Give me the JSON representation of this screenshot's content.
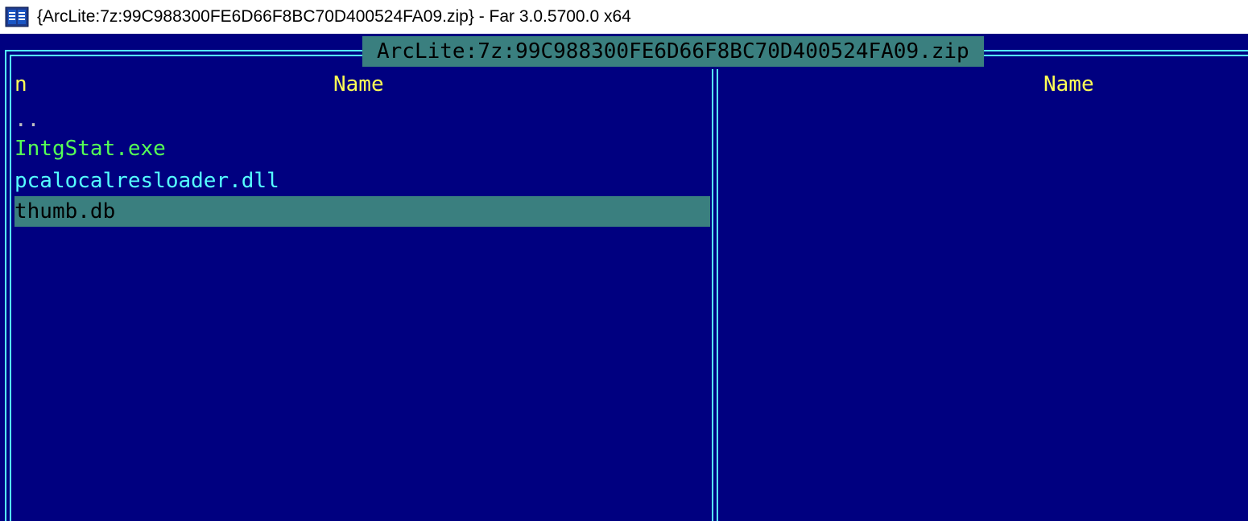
{
  "window": {
    "title": "{ArcLite:7z:99C988300FE6D66F8BC70D400524FA09.zip} - Far 3.0.5700.0 x64",
    "icon": "far-manager-icon"
  },
  "left_panel": {
    "title": "ArcLite:7z:99C988300FE6D66F8BC70D400524FA09.zip",
    "column_marker": "n",
    "column_header": "Name",
    "files": [
      {
        "name": "..",
        "color": "#c0c0c0",
        "selected": false
      },
      {
        "name": "IntgStat.exe",
        "color": "#55ff55",
        "selected": false
      },
      {
        "name": "pcalocalresloader.dll",
        "color": "#55ffff",
        "selected": false
      },
      {
        "name": "thumb.db",
        "color": "#000000",
        "selected": true
      }
    ]
  },
  "right_panel": {
    "column_header": "Name"
  },
  "colors": {
    "background": "#000080",
    "frame": "#55ffff",
    "header": "#ffff55",
    "highlight": "#3a7f7f"
  }
}
